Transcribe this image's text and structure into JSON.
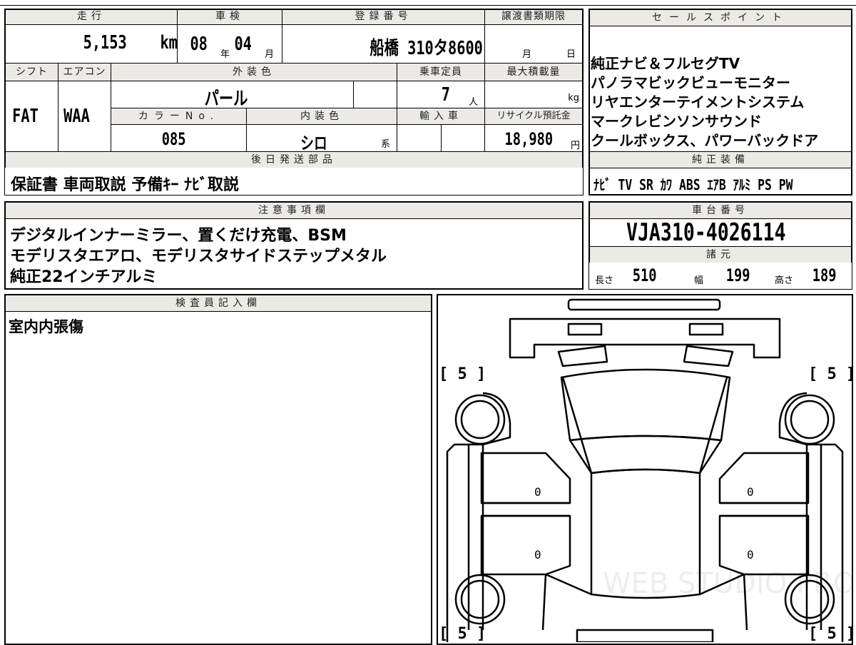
{
  "left_panel": {
    "mileage": {
      "label": "走行",
      "value": "5,153",
      "unit": "km"
    },
    "inspection": {
      "label": "車検",
      "year": "08",
      "year_unit": "年",
      "month": "04",
      "month_unit": "月"
    },
    "registration": {
      "label": "登録番号",
      "value": "船橋 310タ8600"
    },
    "transfer_deadline": {
      "label": "譲渡書類期限",
      "month_unit": "月",
      "day_unit": "日"
    },
    "shift": {
      "label": "シフト",
      "value": "FAT"
    },
    "aircon": {
      "label": "エアコン",
      "value": "WAA"
    },
    "exterior_color": {
      "label": "外装色",
      "value": "パール"
    },
    "capacity": {
      "label": "乗車定員",
      "value": "7",
      "unit": "人"
    },
    "max_load": {
      "label": "最大積載量",
      "unit": "kg"
    },
    "color_no": {
      "label": "カラーNo.",
      "value": "085"
    },
    "interior_color": {
      "label": "内装色",
      "value": "シロ",
      "suffix": "系"
    },
    "import": {
      "label": "輸入車"
    },
    "recycle": {
      "label": "リサイクル預託金",
      "value": "18,980",
      "unit": "円"
    },
    "later_shipping": {
      "label": "後日発送部品",
      "value": "保証書 車両取説 予備ｷｰ ﾅﾋﾞ取説"
    },
    "notes": {
      "label": "注意事項欄",
      "lines": [
        "デジタルインナーミラー、置くだけ充電、BSM",
        "モデリスタエアロ、モデリスタサイドステップメタル",
        "純正22インチアルミ"
      ]
    },
    "inspector": {
      "label": "検査員記入欄",
      "value": "室内内張傷"
    }
  },
  "right_panel": {
    "sales_points": {
      "label": "セールスポイント",
      "lines": [
        "純正ナビ＆フルセグTV",
        "パノラマビックビューモニター",
        "リヤエンターテイメントシステム",
        "マークレビンソンサウンド",
        "クールボックス、パワーバックドア"
      ]
    },
    "equipment": {
      "label": "純正装備",
      "value": "ﾅﾋﾞ TV SR ｶﾜ ABS ｴｱB ｱﾙﾐ PS PW"
    },
    "chassis": {
      "label": "車台番号",
      "value": "VJA310-4026114"
    },
    "specs": {
      "label": "諸元",
      "length_label": "長さ",
      "length": "510",
      "width_label": "幅",
      "width": "199",
      "height_label": "高さ",
      "height": "189"
    }
  },
  "diagram": {
    "tire_tl": "[ 5 ]",
    "tire_tr": "[ 5 ]",
    "tire_bl": "[ 5 ]",
    "tire_br": "[ 5 ]",
    "door_fl": "0",
    "door_rl": "0",
    "door_fr": "0",
    "door_rr": "0",
    "watermark": "WEB STUDIO PRO"
  }
}
